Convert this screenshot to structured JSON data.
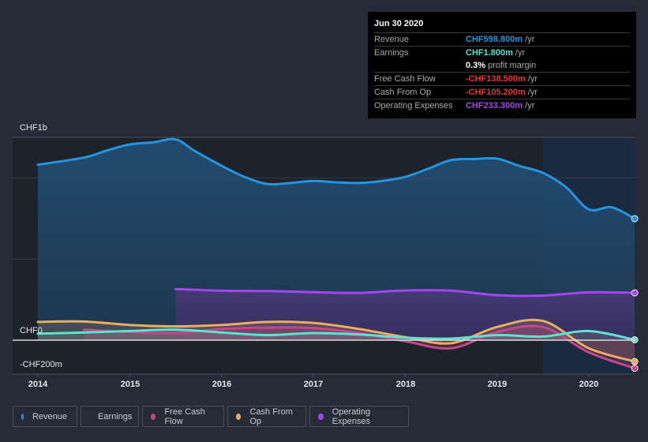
{
  "tooltip": {
    "date": "Jun 30 2020",
    "rows": [
      {
        "label": "Revenue",
        "value": "CHF598.800m",
        "unit": "/yr",
        "color": "#2394df"
      },
      {
        "label": "Earnings",
        "value": "CHF1.800m",
        "unit": "/yr",
        "color": "#5be3d0"
      },
      {
        "label": "",
        "value": "0.3%",
        "unit": "profit margin",
        "color": "#ffffff"
      },
      {
        "label": "Free Cash Flow",
        "value": "-CHF138.500m",
        "unit": "/yr",
        "color": "#e2343c"
      },
      {
        "label": "Cash From Op",
        "value": "-CHF105.200m",
        "unit": "/yr",
        "color": "#e2343c"
      },
      {
        "label": "Operating Expenses",
        "value": "CHF233.300m",
        "unit": "/yr",
        "color": "#a346f0"
      }
    ]
  },
  "legend": [
    {
      "label": "Revenue",
      "color": "#2394df"
    },
    {
      "label": "Earnings",
      "color": "#5be3d0"
    },
    {
      "label": "Free Cash Flow",
      "color": "#c4478a"
    },
    {
      "label": "Cash From Op",
      "color": "#e8ad62"
    },
    {
      "label": "Operating Expenses",
      "color": "#a346f0"
    }
  ],
  "chart_data": {
    "type": "area",
    "title": "",
    "xlabel": "",
    "ylabel": "",
    "y_tick_labels": [
      "CHF1b",
      "CHF0",
      "-CHF200m"
    ],
    "x_tick_labels": [
      "2014",
      "2015",
      "2016",
      "2017",
      "2018",
      "2019",
      "2020"
    ],
    "xlim": [
      2014,
      2020.5
    ],
    "ylim": [
      -167,
      1000
    ],
    "forecast_start": 2019.5,
    "legend_position": "bottom",
    "series": [
      {
        "name": "Revenue",
        "color": "#2394df",
        "x": [
          2014.0,
          2014.5,
          2014.75,
          2015.0,
          2015.25,
          2015.5,
          2015.7,
          2016.0,
          2016.25,
          2016.5,
          2016.75,
          2017.0,
          2017.25,
          2017.5,
          2017.75,
          2018.0,
          2018.25,
          2018.5,
          2018.75,
          2019.0,
          2019.25,
          2019.5,
          2019.75,
          2020.0,
          2020.25,
          2020.5
        ],
        "values": [
          865,
          900,
          935,
          965,
          975,
          990,
          935,
          860,
          805,
          770,
          775,
          785,
          778,
          775,
          785,
          805,
          845,
          888,
          893,
          895,
          858,
          825,
          755,
          645,
          655,
          599
        ]
      },
      {
        "name": "Earnings",
        "color": "#5be3d0",
        "x": [
          2014.0,
          2014.5,
          2015.0,
          2015.5,
          2016.0,
          2016.5,
          2017.0,
          2017.5,
          2018.0,
          2018.5,
          2019.0,
          2019.5,
          2020.0,
          2020.5
        ],
        "values": [
          32,
          38,
          45,
          52,
          38,
          25,
          35,
          28,
          12,
          8,
          25,
          18,
          45,
          2
        ]
      },
      {
        "name": "Free Cash Flow",
        "color": "#c4478a",
        "x": [
          2014.5,
          2015.0,
          2015.5,
          2016.0,
          2016.5,
          2017.0,
          2017.5,
          2018.0,
          2018.5,
          2019.0,
          2019.5,
          2020.0,
          2020.5
        ],
        "values": [
          52,
          40,
          35,
          55,
          62,
          60,
          35,
          -5,
          -40,
          40,
          65,
          -60,
          -138.5
        ]
      },
      {
        "name": "Cash From Op",
        "color": "#e8ad62",
        "x": [
          2014.0,
          2014.5,
          2015.0,
          2015.5,
          2016.0,
          2016.5,
          2017.0,
          2017.5,
          2018.0,
          2018.5,
          2019.0,
          2019.5,
          2020.0,
          2020.5
        ],
        "values": [
          90,
          92,
          75,
          68,
          75,
          90,
          85,
          55,
          15,
          -15,
          65,
          95,
          -40,
          -105.2
        ]
      },
      {
        "name": "Operating Expenses",
        "color": "#a346f0",
        "x": [
          2015.5,
          2016.0,
          2016.5,
          2017.0,
          2017.5,
          2018.0,
          2018.5,
          2019.0,
          2019.5,
          2020.0,
          2020.5
        ],
        "values": [
          252,
          244,
          242,
          237,
          233,
          245,
          244,
          222,
          220,
          236,
          233.3
        ]
      }
    ]
  }
}
